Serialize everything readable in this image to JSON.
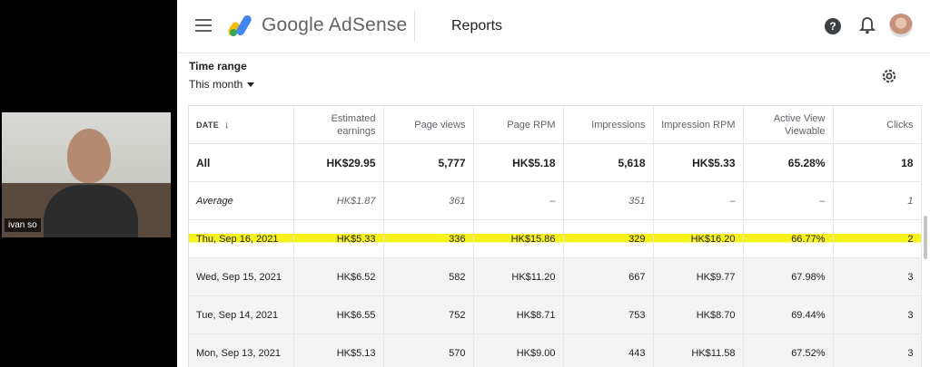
{
  "webcam": {
    "name": "ivan so"
  },
  "header": {
    "brand": "Google AdSense",
    "page_title": "Reports",
    "help_glyph": "?",
    "accent_colors": [
      "#fbbc04",
      "#4285f4",
      "#34a853"
    ]
  },
  "filters": {
    "time_range_label": "Time range",
    "time_range_value": "This month"
  },
  "table": {
    "columns": [
      [
        "DATE"
      ],
      [
        "Estimated",
        "earnings"
      ],
      [
        "Page views"
      ],
      [
        "Page RPM"
      ],
      [
        "Impressions"
      ],
      [
        "Impression RPM"
      ],
      [
        "Active View",
        "Viewable"
      ],
      [
        "Clicks"
      ]
    ],
    "sort_glyph": "↓",
    "rows": [
      {
        "type": "all",
        "cells": [
          "All",
          "HK$29.95",
          "5,777",
          "HK$5.18",
          "5,618",
          "HK$5.33",
          "65.28%",
          "18"
        ]
      },
      {
        "type": "avg",
        "cells": [
          "Average",
          "HK$1.87",
          "361",
          "–",
          "351",
          "–",
          "–",
          "1"
        ]
      },
      {
        "type": "hl",
        "cells": [
          "Thu, Sep 16, 2021",
          "HK$5.33",
          "336",
          "HK$15.86",
          "329",
          "HK$16.20",
          "66.77%",
          "2"
        ]
      },
      {
        "type": "gray",
        "cells": [
          "Wed, Sep 15, 2021",
          "HK$6.52",
          "582",
          "HK$11.20",
          "667",
          "HK$9.77",
          "67.98%",
          "3"
        ]
      },
      {
        "type": "gray",
        "cells": [
          "Tue, Sep 14, 2021",
          "HK$6.55",
          "752",
          "HK$8.71",
          "753",
          "HK$8.70",
          "69.44%",
          "3"
        ]
      },
      {
        "type": "gray",
        "cells": [
          "Mon, Sep 13, 2021",
          "HK$5.13",
          "570",
          "HK$9.00",
          "443",
          "HK$11.58",
          "67.52%",
          "3"
        ]
      }
    ]
  }
}
